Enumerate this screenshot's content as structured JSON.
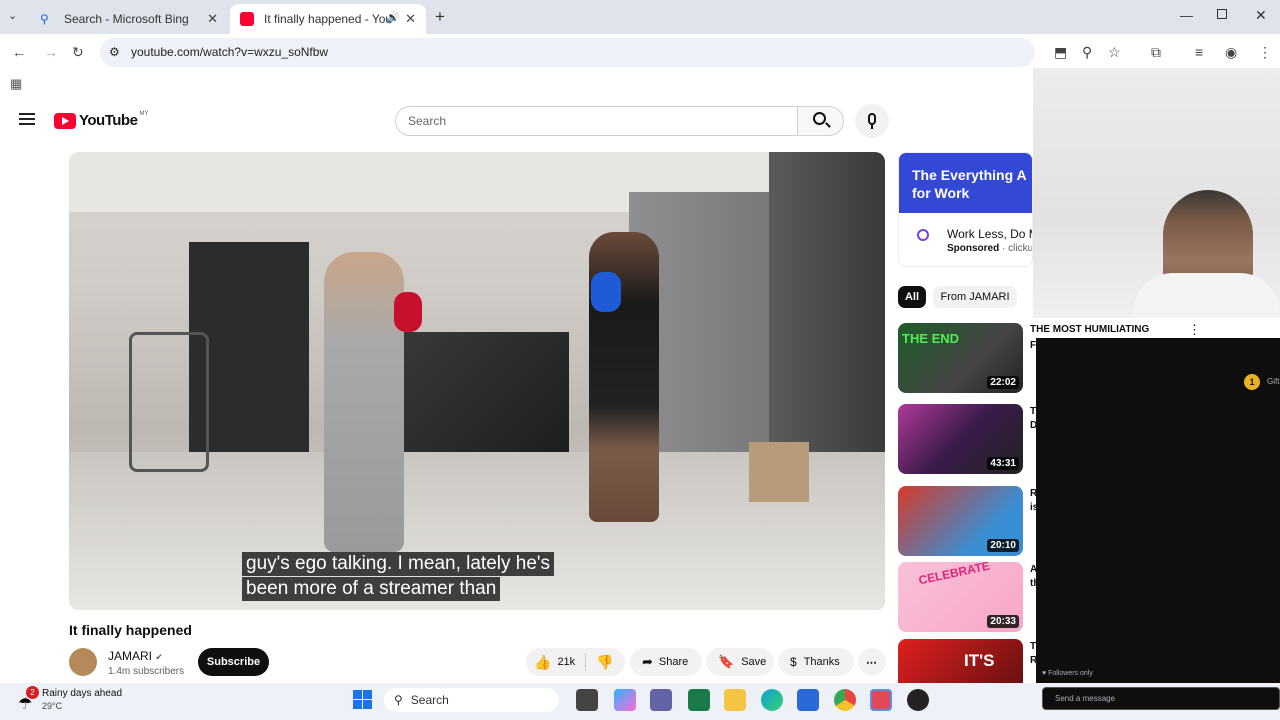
{
  "browser": {
    "tabs": [
      {
        "label": "Search - Microsoft Bing",
        "active": false
      },
      {
        "label": "It finally happened - YouTube",
        "active": true
      }
    ],
    "url": "youtube.com/watch?v=wxzu_soNfbw"
  },
  "youtube": {
    "logo": "YouTube",
    "region": "MY",
    "search_placeholder": "Search",
    "video": {
      "caption_line1": "guy's ego talking. I mean, lately he's",
      "caption_line2": "been more of a streamer than"
    },
    "title": "It finally happened",
    "channel": {
      "name": "JAMARI",
      "subscribers": "1.4m subscribers",
      "subscribe_label": "Subscribe"
    },
    "actions": {
      "likes": "21k",
      "share": "Share",
      "save": "Save",
      "thanks": "Thanks"
    },
    "ad": {
      "headline": "The Everything A",
      "headline2": "for Work",
      "title": "Work Less, Do M",
      "sponsored": "Sponsored",
      "domain": "clickup.co"
    },
    "chips": [
      "All",
      "From JAMARI"
    ],
    "recommendations": [
      {
        "title": "THE MOST HUMILIATING",
        "title2": "F",
        "duration": "22:02",
        "thumb_text": "THE END"
      },
      {
        "title": "T",
        "title2": "D",
        "duration": "43:31",
        "thumb_text": ""
      },
      {
        "title": "R",
        "title2": "is",
        "duration": "20:10",
        "thumb_text": ""
      },
      {
        "title": "A",
        "title2": "th",
        "duration": "20:33",
        "thumb_text": "CELEBRATE"
      },
      {
        "title": "T",
        "title2": "R",
        "duration": "",
        "thumb_text": "IT'S"
      }
    ]
  },
  "stream": {
    "gift_count": "1",
    "gift_label": "Gift",
    "followers_only": "Followers only",
    "send_message": "Send a message"
  },
  "taskbar": {
    "weather_title": "Rainy days ahead",
    "weather_temp": "29°C",
    "weather_badge": "2",
    "search_label": "Search"
  },
  "colors": {
    "yt_red": "#ff0033",
    "tab_bg": "#dfe3eb",
    "taskbar_bg": "#eef2f8",
    "chat_bg": "#0e0e0e"
  }
}
